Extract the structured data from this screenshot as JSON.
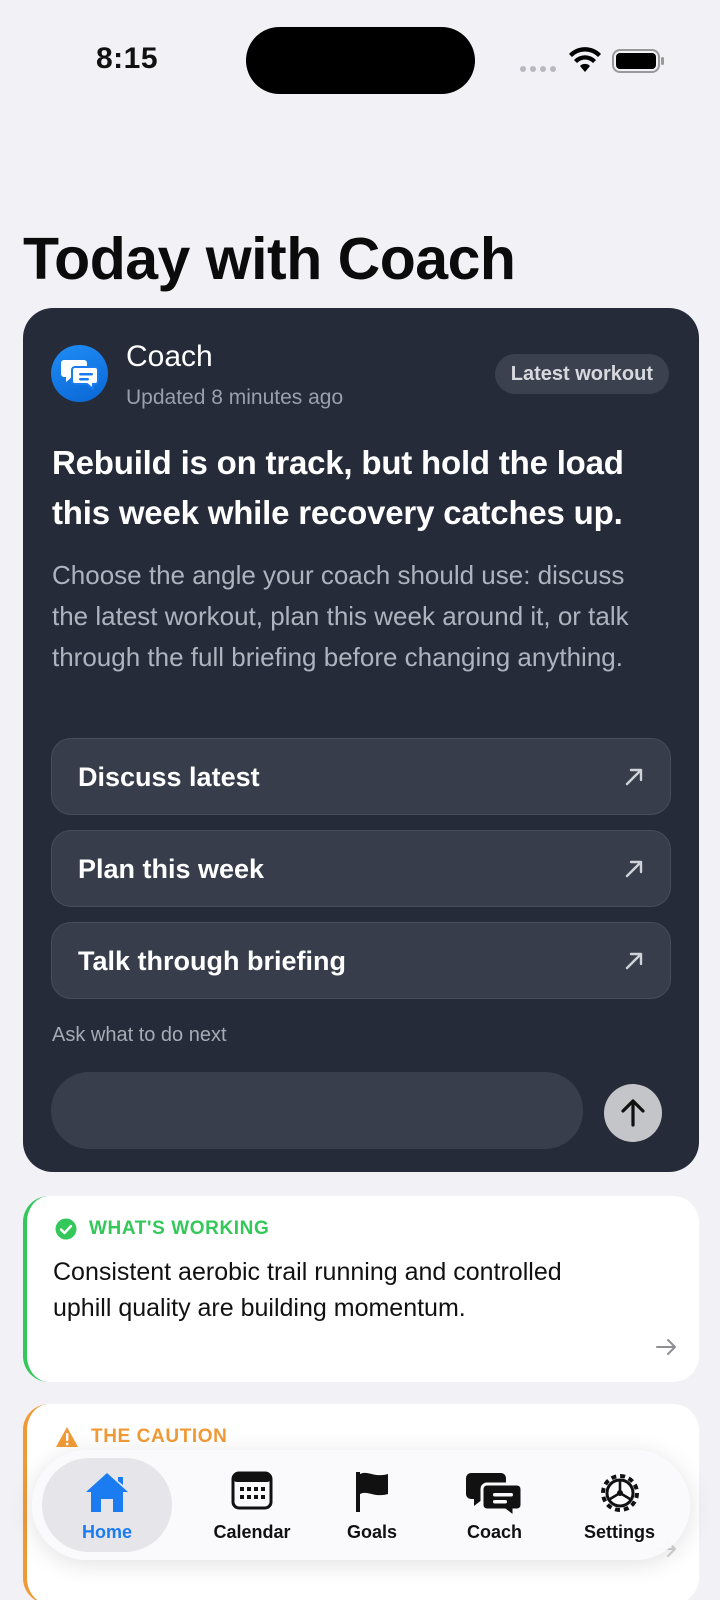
{
  "status_bar": {
    "time": "8:15"
  },
  "page": {
    "title": "Today with Coach"
  },
  "coach_card": {
    "name": "Coach",
    "updated": "Updated 8 minutes ago",
    "badge": "Latest workout",
    "headline": "Rebuild is on track, but hold the load this week while recovery catches up.",
    "body": "Choose the angle your coach should use: discuss the latest workout, plan this week around it, or talk through the full briefing before changing anything.",
    "actions": [
      {
        "label": "Discuss latest",
        "icon": "arrow-up-right-icon"
      },
      {
        "label": "Plan this week",
        "icon": "arrow-up-right-icon"
      },
      {
        "label": "Talk through briefing",
        "icon": "arrow-up-right-icon"
      }
    ],
    "ask_label": "Ask what to do next",
    "ask_value": "",
    "send_icon": "arrow-up-icon"
  },
  "working_card": {
    "tag": "WHAT'S WORKING",
    "text": "Consistent aerobic trail running and controlled uphill quality are building momentum.",
    "color": "#34c759"
  },
  "caution_card": {
    "tag": "THE CAUTION",
    "color": "#f09a37"
  },
  "tab_bar": {
    "selected": "Home",
    "tabs": [
      {
        "label": "Home",
        "icon": "house-icon"
      },
      {
        "label": "Calendar",
        "icon": "calendar-icon"
      },
      {
        "label": "Goals",
        "icon": "flag-icon"
      },
      {
        "label": "Coach",
        "icon": "chat-bubbles-icon"
      },
      {
        "label": "Settings",
        "icon": "gear-icon"
      }
    ],
    "accent": "#1a7cf0"
  }
}
